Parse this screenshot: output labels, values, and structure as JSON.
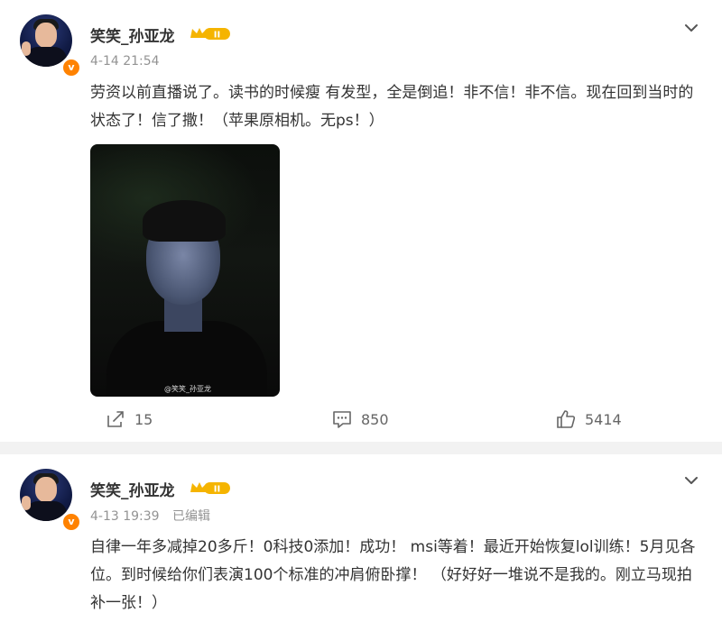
{
  "posts": [
    {
      "username": "笑笑_孙亚龙",
      "level_badge": "II",
      "verified_badge": "v",
      "time": "4-14 21:54",
      "edited": "",
      "content": "劳资以前直播说了。读书的时候瘦 有发型，全是倒追！非不信！非不信。现在回到当时的状态了！信了撒！（苹果原相机。无ps！）",
      "image_watermark": "@笑笑_孙亚龙",
      "repost_count": "15",
      "comment_count": "850",
      "like_count": "5414"
    },
    {
      "username": "笑笑_孙亚龙",
      "level_badge": "II",
      "verified_badge": "v",
      "time": "4-13 19:39",
      "edited": "已编辑",
      "content": "自律一年多减掉20多斤！0科技0添加！成功！ msi等着！最近开始恢复lol训练！5月见各位。到时候给你们表演100个标准的冲肩俯卧撑！ （好好好一堆说不是我的。刚立马现拍补一张！）"
    }
  ],
  "colors": {
    "accent_orange": "#ff8200",
    "crown_gold": "#f5b400",
    "text": "#333333",
    "meta": "#939393",
    "background": "#f2f2f2"
  },
  "icons": {
    "repost": "share-arrow-icon",
    "comment": "comment-bubble-icon",
    "like": "thumbs-up-icon",
    "menu": "chevron-down-icon"
  }
}
